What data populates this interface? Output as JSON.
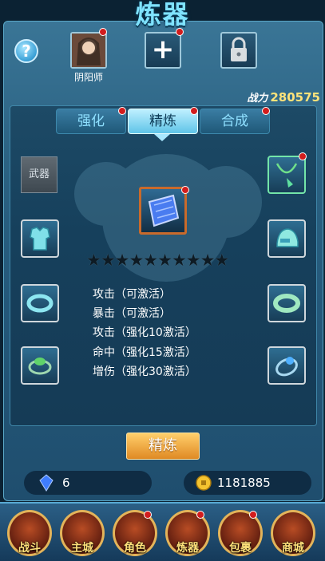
{
  "title": "炼器",
  "header": {
    "help_icon": "?",
    "character_name": "阴阳师",
    "add_icon": "+",
    "lock_icon": "lock"
  },
  "power": {
    "label": "战力",
    "value": "280575"
  },
  "tabs": [
    {
      "label": "强化",
      "active": false,
      "badge": true
    },
    {
      "label": "精炼",
      "active": true,
      "badge": true
    },
    {
      "label": "合成",
      "active": false,
      "badge": true
    }
  ],
  "slots": {
    "weapon_label": "武器"
  },
  "stars": "★★★★★★★★★★",
  "attributes": [
    "攻击（可激活）",
    "暴击（可激活）",
    "攻击（强化10激活）",
    "命中（强化15激活）",
    "增伤（强化30激活）"
  ],
  "action_button": "精炼",
  "currency": {
    "gems": "6",
    "gold": "1181885"
  },
  "nav": [
    "战斗",
    "主城",
    "角色",
    "炼器",
    "包裹",
    "商城"
  ]
}
